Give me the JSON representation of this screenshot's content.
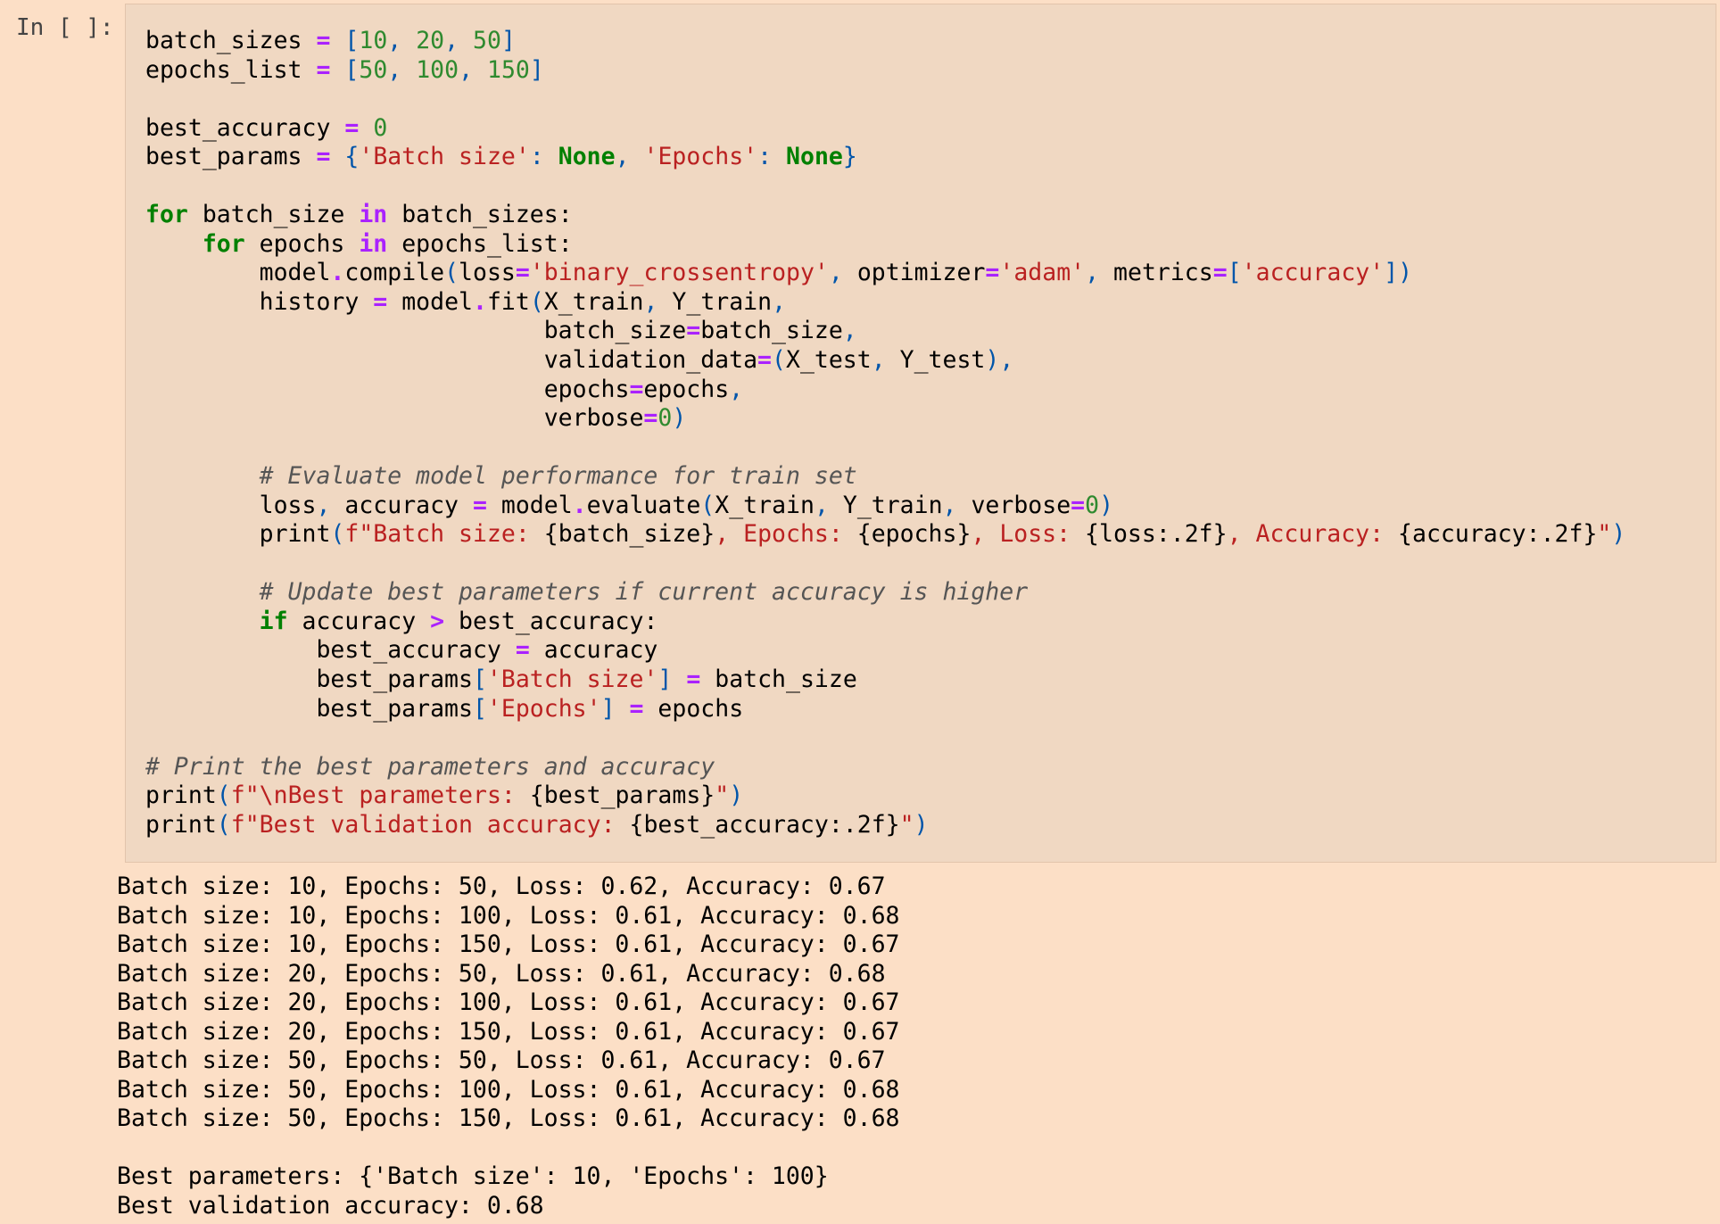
{
  "cell": {
    "prompt": "In [ ]:"
  },
  "code_lines": [
    [
      {
        "t": "batch_sizes ",
        "c": ""
      },
      {
        "t": "=",
        "c": "op"
      },
      {
        "t": " ",
        "c": ""
      },
      {
        "t": "[",
        "c": "pn"
      },
      {
        "t": "10",
        "c": "num"
      },
      {
        "t": ", ",
        "c": "pn"
      },
      {
        "t": "20",
        "c": "num"
      },
      {
        "t": ", ",
        "c": "pn"
      },
      {
        "t": "50",
        "c": "num"
      },
      {
        "t": "]",
        "c": "pn"
      }
    ],
    [
      {
        "t": "epochs_list ",
        "c": ""
      },
      {
        "t": "=",
        "c": "op"
      },
      {
        "t": " ",
        "c": ""
      },
      {
        "t": "[",
        "c": "pn"
      },
      {
        "t": "50",
        "c": "num"
      },
      {
        "t": ", ",
        "c": "pn"
      },
      {
        "t": "100",
        "c": "num"
      },
      {
        "t": ", ",
        "c": "pn"
      },
      {
        "t": "150",
        "c": "num"
      },
      {
        "t": "]",
        "c": "pn"
      }
    ],
    [],
    [
      {
        "t": "best_accuracy ",
        "c": ""
      },
      {
        "t": "=",
        "c": "op"
      },
      {
        "t": " ",
        "c": ""
      },
      {
        "t": "0",
        "c": "num"
      }
    ],
    [
      {
        "t": "best_params ",
        "c": ""
      },
      {
        "t": "=",
        "c": "op"
      },
      {
        "t": " ",
        "c": ""
      },
      {
        "t": "{",
        "c": "pn"
      },
      {
        "t": "'Batch size'",
        "c": "str"
      },
      {
        "t": ": ",
        "c": "pn"
      },
      {
        "t": "None",
        "c": "nc"
      },
      {
        "t": ", ",
        "c": "pn"
      },
      {
        "t": "'Epochs'",
        "c": "str"
      },
      {
        "t": ": ",
        "c": "pn"
      },
      {
        "t": "None",
        "c": "nc"
      },
      {
        "t": "}",
        "c": "pn"
      }
    ],
    [],
    [
      {
        "t": "for",
        "c": "kw"
      },
      {
        "t": " batch_size ",
        "c": ""
      },
      {
        "t": "in",
        "c": "kwi"
      },
      {
        "t": " batch_sizes:",
        "c": ""
      }
    ],
    [
      {
        "t": "    ",
        "c": ""
      },
      {
        "t": "for",
        "c": "kw"
      },
      {
        "t": " epochs ",
        "c": ""
      },
      {
        "t": "in",
        "c": "kwi"
      },
      {
        "t": " epochs_list:",
        "c": ""
      }
    ],
    [
      {
        "t": "        model",
        "c": ""
      },
      {
        "t": ".",
        "c": "op"
      },
      {
        "t": "compile",
        "c": ""
      },
      {
        "t": "(",
        "c": "pn"
      },
      {
        "t": "loss",
        "c": ""
      },
      {
        "t": "=",
        "c": "op"
      },
      {
        "t": "'binary_crossentropy'",
        "c": "str"
      },
      {
        "t": ", ",
        "c": "pn"
      },
      {
        "t": "optimizer",
        "c": ""
      },
      {
        "t": "=",
        "c": "op"
      },
      {
        "t": "'adam'",
        "c": "str"
      },
      {
        "t": ", ",
        "c": "pn"
      },
      {
        "t": "metrics",
        "c": ""
      },
      {
        "t": "=",
        "c": "op"
      },
      {
        "t": "[",
        "c": "pn"
      },
      {
        "t": "'accuracy'",
        "c": "str"
      },
      {
        "t": "])",
        "c": "pn"
      }
    ],
    [
      {
        "t": "        history ",
        "c": ""
      },
      {
        "t": "=",
        "c": "op"
      },
      {
        "t": " model",
        "c": ""
      },
      {
        "t": ".",
        "c": "op"
      },
      {
        "t": "fit",
        "c": ""
      },
      {
        "t": "(",
        "c": "pn"
      },
      {
        "t": "X_train",
        "c": ""
      },
      {
        "t": ", ",
        "c": "pn"
      },
      {
        "t": "Y_train",
        "c": ""
      },
      {
        "t": ",",
        "c": "pn"
      }
    ],
    [
      {
        "t": "                            batch_size",
        "c": ""
      },
      {
        "t": "=",
        "c": "op"
      },
      {
        "t": "batch_size",
        "c": ""
      },
      {
        "t": ",",
        "c": "pn"
      }
    ],
    [
      {
        "t": "                            validation_data",
        "c": ""
      },
      {
        "t": "=",
        "c": "op"
      },
      {
        "t": "(",
        "c": "pn"
      },
      {
        "t": "X_test",
        "c": ""
      },
      {
        "t": ", ",
        "c": "pn"
      },
      {
        "t": "Y_test",
        "c": ""
      },
      {
        "t": "),",
        "c": "pn"
      }
    ],
    [
      {
        "t": "                            epochs",
        "c": ""
      },
      {
        "t": "=",
        "c": "op"
      },
      {
        "t": "epochs",
        "c": ""
      },
      {
        "t": ",",
        "c": "pn"
      }
    ],
    [
      {
        "t": "                            verbose",
        "c": ""
      },
      {
        "t": "=",
        "c": "op"
      },
      {
        "t": "0",
        "c": "num"
      },
      {
        "t": ")",
        "c": "pn"
      }
    ],
    [],
    [
      {
        "t": "        ",
        "c": ""
      },
      {
        "t": "# Evaluate model performance for train set",
        "c": "cm"
      }
    ],
    [
      {
        "t": "        loss",
        "c": ""
      },
      {
        "t": ", ",
        "c": "pn"
      },
      {
        "t": "accuracy ",
        "c": ""
      },
      {
        "t": "=",
        "c": "op"
      },
      {
        "t": " model",
        "c": ""
      },
      {
        "t": ".",
        "c": "op"
      },
      {
        "t": "evaluate",
        "c": ""
      },
      {
        "t": "(",
        "c": "pn"
      },
      {
        "t": "X_train",
        "c": ""
      },
      {
        "t": ", ",
        "c": "pn"
      },
      {
        "t": "Y_train",
        "c": ""
      },
      {
        "t": ", ",
        "c": "pn"
      },
      {
        "t": "verbose",
        "c": ""
      },
      {
        "t": "=",
        "c": "op"
      },
      {
        "t": "0",
        "c": "num"
      },
      {
        "t": ")",
        "c": "pn"
      }
    ],
    [
      {
        "t": "        print",
        "c": ""
      },
      {
        "t": "(",
        "c": "pn"
      },
      {
        "t": "f\"Batch size: ",
        "c": "str"
      },
      {
        "t": "{batch_size}",
        "c": ""
      },
      {
        "t": ", Epochs: ",
        "c": "str"
      },
      {
        "t": "{epochs}",
        "c": ""
      },
      {
        "t": ", Loss: ",
        "c": "str"
      },
      {
        "t": "{loss:.2f}",
        "c": ""
      },
      {
        "t": ", Accuracy: ",
        "c": "str"
      },
      {
        "t": "{accuracy:.2f}",
        "c": ""
      },
      {
        "t": "\"",
        "c": "str"
      },
      {
        "t": ")",
        "c": "pn"
      }
    ],
    [],
    [
      {
        "t": "        ",
        "c": ""
      },
      {
        "t": "# Update best parameters if current accuracy is higher",
        "c": "cm"
      }
    ],
    [
      {
        "t": "        ",
        "c": ""
      },
      {
        "t": "if",
        "c": "kw"
      },
      {
        "t": " accuracy ",
        "c": ""
      },
      {
        "t": ">",
        "c": "op"
      },
      {
        "t": " best_accuracy:",
        "c": ""
      }
    ],
    [
      {
        "t": "            best_accuracy ",
        "c": ""
      },
      {
        "t": "=",
        "c": "op"
      },
      {
        "t": " accuracy",
        "c": ""
      }
    ],
    [
      {
        "t": "            best_params",
        "c": ""
      },
      {
        "t": "[",
        "c": "pn"
      },
      {
        "t": "'Batch size'",
        "c": "str"
      },
      {
        "t": "]",
        "c": "pn"
      },
      {
        "t": " ",
        "c": ""
      },
      {
        "t": "=",
        "c": "op"
      },
      {
        "t": " batch_size",
        "c": ""
      }
    ],
    [
      {
        "t": "            best_params",
        "c": ""
      },
      {
        "t": "[",
        "c": "pn"
      },
      {
        "t": "'Epochs'",
        "c": "str"
      },
      {
        "t": "]",
        "c": "pn"
      },
      {
        "t": " ",
        "c": ""
      },
      {
        "t": "=",
        "c": "op"
      },
      {
        "t": " epochs",
        "c": ""
      }
    ],
    [],
    [
      {
        "t": "# Print the best parameters and accuracy",
        "c": "cm"
      }
    ],
    [
      {
        "t": "print",
        "c": ""
      },
      {
        "t": "(",
        "c": "pn"
      },
      {
        "t": "f\"",
        "c": "str"
      },
      {
        "t": "\\n",
        "c": "str"
      },
      {
        "t": "Best parameters: ",
        "c": "str"
      },
      {
        "t": "{best_params}",
        "c": ""
      },
      {
        "t": "\"",
        "c": "str"
      },
      {
        "t": ")",
        "c": "pn"
      }
    ],
    [
      {
        "t": "print",
        "c": ""
      },
      {
        "t": "(",
        "c": "pn"
      },
      {
        "t": "f\"Best validation accuracy: ",
        "c": "str"
      },
      {
        "t": "{best_accuracy:.2f}",
        "c": ""
      },
      {
        "t": "\"",
        "c": "str"
      },
      {
        "t": ")",
        "c": "pn"
      }
    ]
  ],
  "output_lines": [
    "Batch size: 10, Epochs: 50, Loss: 0.62, Accuracy: 0.67",
    "Batch size: 10, Epochs: 100, Loss: 0.61, Accuracy: 0.68",
    "Batch size: 10, Epochs: 150, Loss: 0.61, Accuracy: 0.67",
    "Batch size: 20, Epochs: 50, Loss: 0.61, Accuracy: 0.68",
    "Batch size: 20, Epochs: 100, Loss: 0.61, Accuracy: 0.67",
    "Batch size: 20, Epochs: 150, Loss: 0.61, Accuracy: 0.67",
    "Batch size: 50, Epochs: 50, Loss: 0.61, Accuracy: 0.67",
    "Batch size: 50, Epochs: 100, Loss: 0.61, Accuracy: 0.68",
    "Batch size: 50, Epochs: 150, Loss: 0.61, Accuracy: 0.68",
    "",
    "Best parameters: {'Batch size': 10, 'Epochs': 100}",
    "Best validation accuracy: 0.68"
  ]
}
